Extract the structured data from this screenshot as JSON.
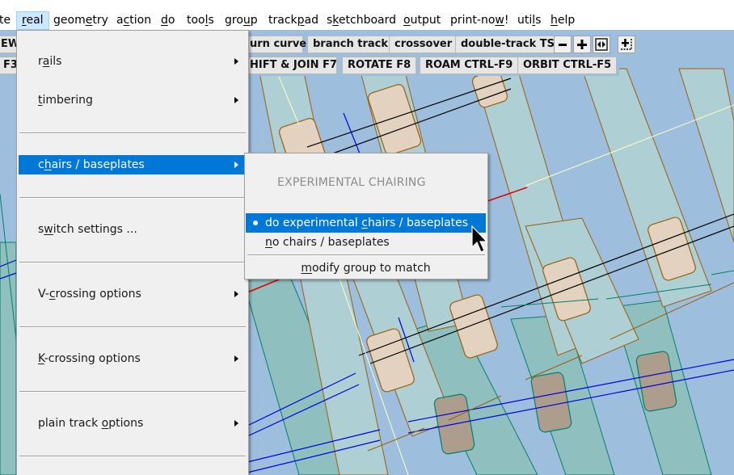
{
  "menubar": {
    "items": [
      {
        "label_pre": "te",
        "label_u": "",
        "label_post": "",
        "state": "normal"
      },
      {
        "label_pre": "",
        "label_u": "r",
        "label_post": "eal",
        "state": "open"
      },
      {
        "label_pre": "geom",
        "label_u": "e",
        "label_post": "try",
        "state": "normal"
      },
      {
        "label_pre": "a",
        "label_u": "c",
        "label_post": "tion",
        "state": "normal"
      },
      {
        "label_pre": "",
        "label_u": "d",
        "label_post": "o",
        "state": "normal"
      },
      {
        "label_pre": "too",
        "label_u": "l",
        "label_post": "s",
        "state": "normal"
      },
      {
        "label_pre": "gro",
        "label_u": "u",
        "label_post": "p",
        "state": "normal"
      },
      {
        "label_pre": "track",
        "label_u": "p",
        "label_post": "ad",
        "state": "normal"
      },
      {
        "label_pre": "s",
        "label_u": "k",
        "label_post": "etchboard",
        "state": "normal"
      },
      {
        "label_pre": "",
        "label_u": "o",
        "label_post": "utput",
        "state": "normal"
      },
      {
        "label_pre": "print-no",
        "label_u": "w",
        "label_post": "!",
        "state": "normal"
      },
      {
        "label_pre": "uti",
        "label_u": "l",
        "label_post": "s",
        "state": "normal"
      },
      {
        "label_pre": "",
        "label_u": "h",
        "label_post": "elp",
        "state": "normal"
      }
    ]
  },
  "toolbar_row1": {
    "left_clipped": "EW",
    "buttons": [
      "urn curve",
      "branch track",
      "crossover",
      "double-track TS"
    ],
    "icon_buttons": [
      {
        "name": "zoom-out-icon",
        "glyph": "minus"
      },
      {
        "name": "zoom-in-icon",
        "glyph": "plus"
      },
      {
        "name": "fit-width-icon",
        "glyph": "left-right-arrows"
      },
      {
        "name": "spacing-icon",
        "glyph": "plus-dotted"
      }
    ]
  },
  "toolbar_row2": {
    "left_clipped": "F3",
    "buttons": [
      "HIFT & JOIN  F7",
      "ROTATE  F8",
      "ROAM  CTRL-F9",
      "ORBIT  CTRL-F5"
    ]
  },
  "real_menu": {
    "items": [
      {
        "pre": "r",
        "u": "a",
        "post": "ils",
        "submenu": true,
        "highlighted": false
      },
      {
        "pre": "",
        "u": "t",
        "post": "imbering",
        "submenu": true,
        "highlighted": false
      },
      {
        "pre": "c",
        "u": "h",
        "post": "airs / baseplates",
        "submenu": true,
        "highlighted": true
      },
      {
        "pre": "s",
        "u": "w",
        "post": "itch  settings ...",
        "submenu": false,
        "highlighted": false
      },
      {
        "pre": "V-",
        "u": "c",
        "post": "rossing  options",
        "submenu": true,
        "highlighted": false
      },
      {
        "pre": "",
        "u": "K",
        "post": "-crossing  options",
        "submenu": true,
        "highlighted": false
      },
      {
        "pre": "plain  track  ",
        "u": "o",
        "post": "ptions",
        "submenu": true,
        "highlighted": false
      }
    ]
  },
  "chairs_submenu": {
    "heading": "EXPERIMENTAL  CHAIRING",
    "items": [
      {
        "pre": "do  experimental  ",
        "u": "c",
        "post": "hairs / baseplates",
        "selected": true,
        "highlighted": true
      },
      {
        "pre": "",
        "u": "n",
        "post": "o  chairs / baseplates",
        "selected": false,
        "highlighted": false
      }
    ],
    "action": {
      "pre": "",
      "u": "m",
      "post": "odify  group  to  match"
    }
  },
  "colors": {
    "canvas_bg": "#9dbfdd",
    "menu_bg": "#f0f0f0",
    "highlight": "#0078d7",
    "menubar_active": "#cce8ff",
    "timber_fill": "#aecfd4",
    "timber_edge": "#9a5f0a",
    "chair_fill": "#e3d2bf",
    "chair_dark_fill": "#ad9d8c",
    "teal_fill": "#8fbfbf",
    "teal_line": "#00806a",
    "rail_blue": "#0000e0"
  }
}
